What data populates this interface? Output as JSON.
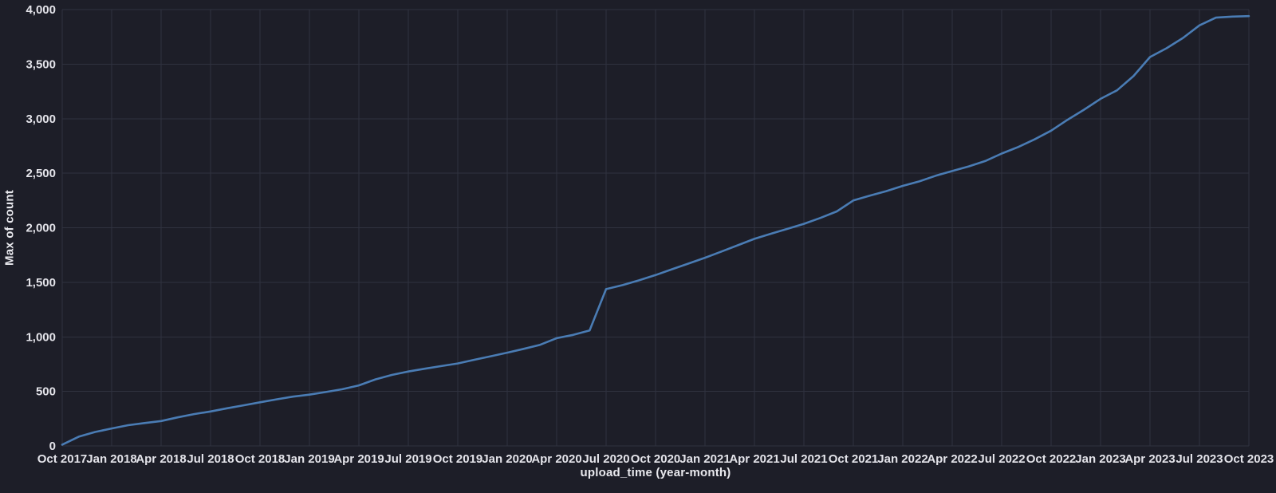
{
  "page": {
    "background_color": "#1d1e28"
  },
  "chart_data": {
    "type": "line",
    "title": "",
    "xlabel": "upload_time (year-month)",
    "ylabel": "Max of count",
    "legend": false,
    "grid": true,
    "ylim": [
      0,
      4000
    ],
    "y_ticks": [
      0,
      500,
      1000,
      1500,
      2000,
      2500,
      3000,
      3500,
      4000
    ],
    "y_tick_labels": [
      "0",
      "500",
      "1,000",
      "1,500",
      "2,000",
      "2,500",
      "3,000",
      "3,500",
      "4,000"
    ],
    "x_tick_every_n_months": 3,
    "x_tick_labels": [
      "Oct 2017",
      "Jan 2018",
      "Apr 2018",
      "Jul 2018",
      "Oct 2018",
      "Jan 2019",
      "Apr 2019",
      "Jul 2019",
      "Oct 2019",
      "Jan 2020",
      "Apr 2020",
      "Jul 2020",
      "Oct 2020",
      "Jan 2021",
      "Apr 2021",
      "Jul 2021",
      "Oct 2021",
      "Jan 2022",
      "Apr 2022",
      "Jul 2022",
      "Oct 2022",
      "Jan 2023",
      "Apr 2023",
      "Jul 2023",
      "Oct 2023"
    ],
    "x": [
      "2017-10",
      "2017-11",
      "2017-12",
      "2018-01",
      "2018-02",
      "2018-03",
      "2018-04",
      "2018-05",
      "2018-06",
      "2018-07",
      "2018-08",
      "2018-09",
      "2018-10",
      "2018-11",
      "2018-12",
      "2019-01",
      "2019-02",
      "2019-03",
      "2019-04",
      "2019-05",
      "2019-06",
      "2019-07",
      "2019-08",
      "2019-09",
      "2019-10",
      "2019-11",
      "2019-12",
      "2020-01",
      "2020-02",
      "2020-03",
      "2020-04",
      "2020-05",
      "2020-06",
      "2020-07",
      "2020-08",
      "2020-09",
      "2020-10",
      "2020-11",
      "2020-12",
      "2021-01",
      "2021-02",
      "2021-03",
      "2021-04",
      "2021-05",
      "2021-06",
      "2021-07",
      "2021-08",
      "2021-09",
      "2021-10",
      "2021-11",
      "2021-12",
      "2022-01",
      "2022-02",
      "2022-03",
      "2022-04",
      "2022-05",
      "2022-06",
      "2022-07",
      "2022-08",
      "2022-09",
      "2022-10",
      "2022-11",
      "2022-12",
      "2023-01",
      "2023-02",
      "2023-03",
      "2023-04",
      "2023-05",
      "2023-06",
      "2023-07",
      "2023-08",
      "2023-09",
      "2023-10"
    ],
    "series": [
      {
        "name": "Max of count",
        "values": [
          12,
          85,
          128,
          160,
          190,
          210,
          228,
          262,
          292,
          316,
          345,
          372,
          400,
          427,
          452,
          470,
          494,
          520,
          555,
          610,
          651,
          682,
          708,
          732,
          756,
          790,
          822,
          855,
          890,
          927,
          988,
          1018,
          1058,
          1438,
          1474,
          1518,
          1566,
          1620,
          1672,
          1725,
          1782,
          1840,
          1898,
          1945,
          1990,
          2036,
          2090,
          2150,
          2250,
          2294,
          2336,
          2384,
          2425,
          2477,
          2520,
          2562,
          2611,
          2680,
          2740,
          2810,
          2890,
          2990,
          3082,
          3182,
          3260,
          3390,
          3565,
          3645,
          3740,
          3855,
          3926,
          3936,
          3940
        ]
      }
    ],
    "colors": {
      "line": "#4a7cb4",
      "background": "#1d1e28",
      "gridline": "#30323f",
      "tick_text": "#e4e4ea",
      "axis_title_text": "#e9e9ee"
    }
  }
}
